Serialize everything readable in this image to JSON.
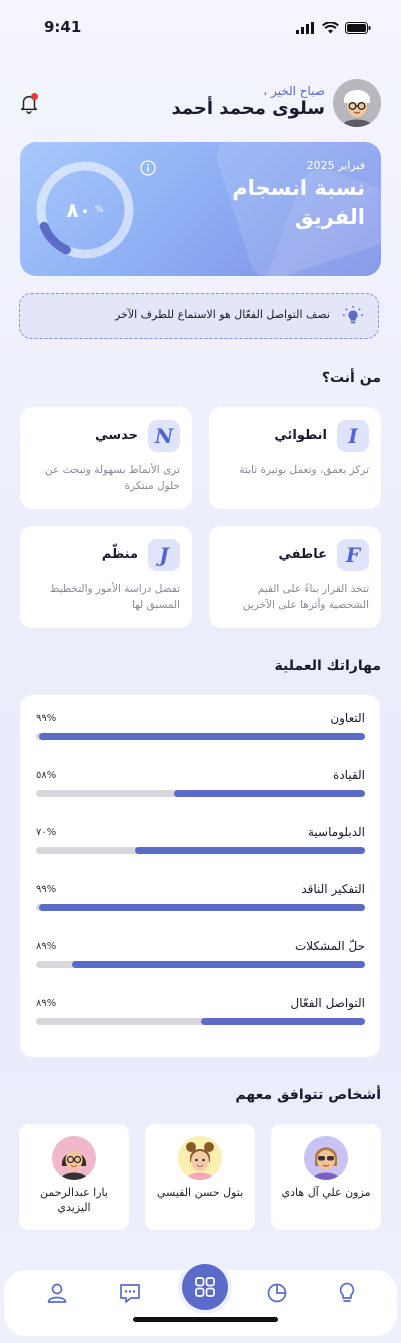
{
  "status_bar": {
    "time": "9:41"
  },
  "header": {
    "greeting": "صباح الخير ،",
    "user_name": "سلوى محمد أحمد"
  },
  "hero": {
    "date": "فبراير 2025",
    "title": "نسبة انسجام الفريق",
    "value": "٨٠",
    "percent_sign": "%",
    "fraction": 0.8
  },
  "tip": {
    "text": "نصف التواصل الفعّال هو الاستماع للطرف الآخر"
  },
  "personality": {
    "title": "من أنت؟",
    "cards": [
      {
        "letter": "I",
        "name": "انطوائي",
        "desc": "تركز بعمق، وتعمل بوتيرة ثابتة"
      },
      {
        "letter": "N",
        "name": "حدسي",
        "desc": "ترى الأنماط بسهولة وتبحث عن حلول مبتكرة"
      },
      {
        "letter": "F",
        "name": "عاطفي",
        "desc": "تتخذ القرار بناءً على القيم الشخصية وأثرها على الآخرين"
      },
      {
        "letter": "J",
        "name": "منظّم",
        "desc": "تفضل دراسة الأمور والتخطيط المسبق لها"
      }
    ]
  },
  "skills": {
    "title": "مهاراتك العملية",
    "items": [
      {
        "name": "التعاون",
        "label": "٩٩%",
        "fill": 0.99
      },
      {
        "name": "القيادة",
        "label": "٥٨%",
        "fill": 0.58
      },
      {
        "name": "الدبلوماسية",
        "label": "٧٠%",
        "fill": 0.7
      },
      {
        "name": "التفكير الناقد",
        "label": "٩٩%",
        "fill": 0.99
      },
      {
        "name": "حلّ المشكلات",
        "label": "٨٩%",
        "fill": 0.89
      },
      {
        "name": "التواصل الفعّال",
        "label": "٨٩%",
        "fill": 0.5
      }
    ]
  },
  "people": {
    "title": "أشخاص تتوافق معهم",
    "items": [
      {
        "name": "مزون علي آل هادي",
        "avatar_bg": "#c9c3f4"
      },
      {
        "name": "بتول حسن القيسي",
        "avatar_bg": "#fbf0b0"
      },
      {
        "name": "يارا عبدالرحمن اليزيدي",
        "avatar_bg": "#f1b8cc"
      }
    ]
  },
  "colors": {
    "accent": "#5a6cc8",
    "track": "#d8d8dc"
  }
}
